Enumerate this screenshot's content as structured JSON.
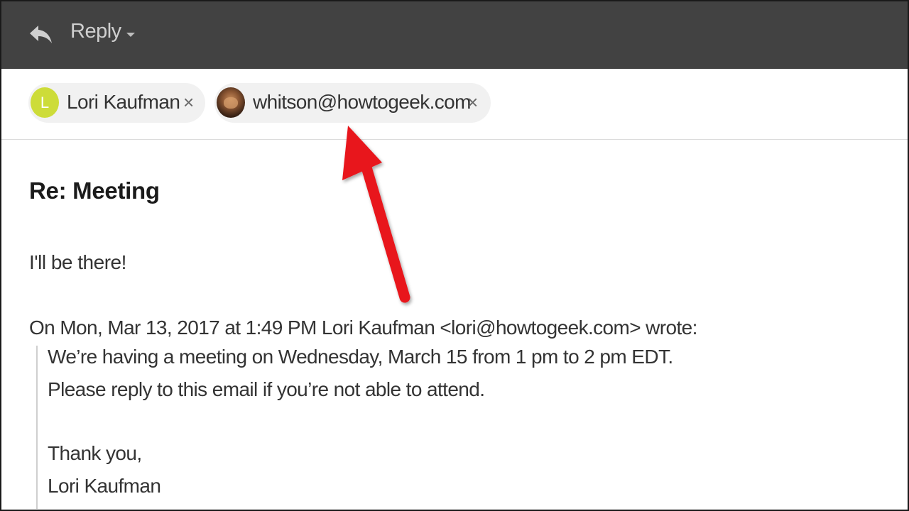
{
  "toolbar": {
    "reply_label": "Reply",
    "reply_icon": "reply-arrow-icon",
    "menu_icon": "caret-down-icon"
  },
  "recipients": [
    {
      "avatar_letter": "L",
      "avatar_color": "#cddc39",
      "name": "Lori Kaufman",
      "remove": "×"
    },
    {
      "avatar": "photo",
      "name": "whitson@howtogeek.com",
      "remove": "×"
    }
  ],
  "email": {
    "subject": "Re: Meeting",
    "message": "I'll be there!",
    "attribution": "On Mon, Mar 13, 2017 at 1:49 PM Lori Kaufman <lori@howtogeek.com> wrote:",
    "quoted": [
      "We’re having a meeting on Wednesday, March 15 from 1 pm to 2 pm EDT.",
      "Please reply to this email if you’re not able to attend.",
      "Thank you,",
      "Lori Kaufman"
    ]
  },
  "colors": {
    "toolbar_bg": "#424242",
    "annotation_arrow": "#e8141b",
    "chip_bg": "#f1f1f1"
  }
}
